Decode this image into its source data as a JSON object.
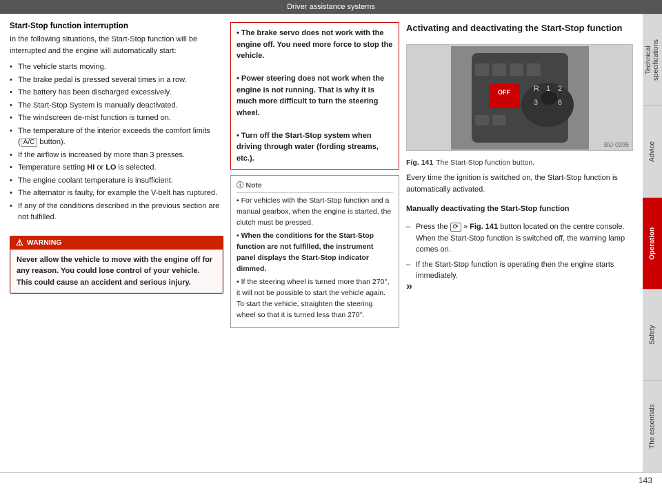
{
  "header": {
    "title": "Driver assistance systems"
  },
  "left_column": {
    "heading": "Start-Stop function interruption",
    "intro": "In the following situations, the Start-Stop function will be interrupted and the engine will automatically start:",
    "bullets": [
      "The vehicle starts moving.",
      "The brake pedal is pressed several times in a row.",
      "The battery has been discharged excessively.",
      "The Start-Stop System is manually deactivated.",
      "The windscreen de-mist function is turned on.",
      "The temperature of the interior exceeds the comfort limits ( button).",
      "If the airflow is increased by more than 3 presses.",
      "Temperature setting HI or LO is selected.",
      "The engine coolant temperature is insufficient.",
      "The alternator is faulty, for example the V-belt has ruptured.",
      "If any of the conditions described in the previous section are not fulfilled."
    ],
    "warning": {
      "header": "WARNING",
      "body": "Never allow the vehicle to move with the engine off for any reason. You could lose control of your vehicle. This could cause an accident and serious injury."
    }
  },
  "middle_column": {
    "red_box": {
      "lines": [
        {
          "bold": true,
          "text": "The brake servo does not work with the engine off. You need more force to stop the vehicle."
        },
        {
          "bold": true,
          "text": "Power steering does not work when the engine is not running. That is why it is much more difficult to turn the steering wheel."
        },
        {
          "bold": true,
          "text": "Turn off the Start-Stop system when driving through water (fording streams, etc.)."
        }
      ]
    },
    "note_box": {
      "header": "Note",
      "items": [
        {
          "bold": false,
          "text": "For vehicles with the Start-Stop function and a manual gearbox, when the engine is started, the clutch must be pressed."
        },
        {
          "bold": true,
          "text": "When the conditions for the Start-Stop function are not fulfilled, the instrument panel displays the Start-Stop indicator dimmed."
        },
        {
          "bold": false,
          "text": "If the steering wheel is turned more than 270°, it will not be possible to start the vehicle again. To start the vehicle, straighten the steering wheel so that it is turned less than 270°."
        }
      ]
    }
  },
  "right_column": {
    "heading": "Activating and deactivating the Start-Stop function",
    "figure": {
      "number": "Fig. 141",
      "caption": "The Start-Stop function button.",
      "image_label": "BIJ-0395"
    },
    "body1": "Every time the ignition is switched on, the Start-Stop function is automatically activated.",
    "subheading": "Manually deactivating the Start-Stop function",
    "dash_items": [
      "Press the  »  Fig. 141  button located on the centre console. When the Start-Stop function is switched off, the warning lamp comes on.",
      "If the Start-Stop function is operating then the engine starts immediately."
    ]
  },
  "sidebar": {
    "tabs": [
      {
        "label": "Technical specifications",
        "active": false
      },
      {
        "label": "Advice",
        "active": false
      },
      {
        "label": "Operation",
        "active": true
      },
      {
        "label": "Safety",
        "active": false
      },
      {
        "label": "The essentials",
        "active": false
      }
    ]
  },
  "footer": {
    "page_number": "143"
  },
  "icons": {
    "warning": "⚠",
    "bullet": "•",
    "dash": "–",
    "arrow_right": "»"
  }
}
